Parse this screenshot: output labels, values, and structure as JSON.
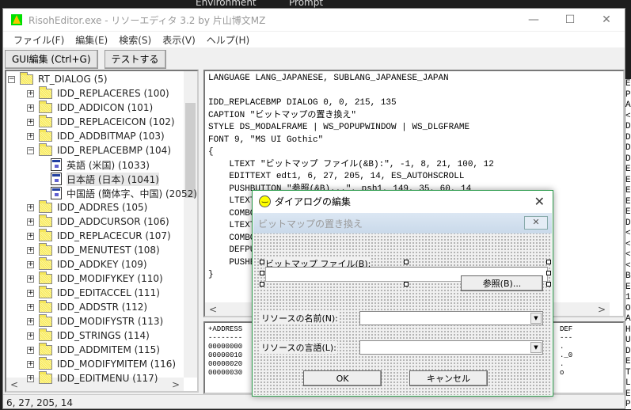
{
  "desktop": {
    "labels": [
      "Environment",
      "Prompt"
    ]
  },
  "window": {
    "title": "RisohEditor.exe - リソーエディタ 3.2 by 片山博文MZ",
    "controls": {
      "minimize": "—",
      "maximize": "☐",
      "close": "✕"
    }
  },
  "menu": [
    "ファイル(F)",
    "編集(E)",
    "検索(S)",
    "表示(V)",
    "ヘルプ(H)"
  ],
  "toolbar": {
    "gui_edit": "GUI編集 (Ctrl+G)",
    "test": "テストする"
  },
  "tree": {
    "root": "RT_DIALOG (5)",
    "items": [
      {
        "label": "IDD_REPLACERES (100)",
        "expanded": false
      },
      {
        "label": "IDD_ADDICON (101)",
        "expanded": false
      },
      {
        "label": "IDD_REPLACEICON (102)",
        "expanded": false
      },
      {
        "label": "IDD_ADDBITMAP (103)",
        "expanded": false
      },
      {
        "label": "IDD_REPLACEBMP (104)",
        "expanded": true,
        "children": [
          "英語 (米国) (1033)",
          "日本語 (日本) (1041)",
          "中国語 (簡体字、中国) (2052)"
        ],
        "selected_child": 1
      },
      {
        "label": "IDD_ADDRES (105)",
        "expanded": false
      },
      {
        "label": "IDD_ADDCURSOR (106)",
        "expanded": false
      },
      {
        "label": "IDD_REPLACECUR (107)",
        "expanded": false
      },
      {
        "label": "IDD_MENUTEST (108)",
        "expanded": false
      },
      {
        "label": "IDD_ADDKEY (109)",
        "expanded": false
      },
      {
        "label": "IDD_MODIFYKEY (110)",
        "expanded": false
      },
      {
        "label": "IDD_EDITACCEL (111)",
        "expanded": false
      },
      {
        "label": "IDD_ADDSTR (112)",
        "expanded": false
      },
      {
        "label": "IDD_MODIFYSTR (113)",
        "expanded": false
      },
      {
        "label": "IDD_STRINGS (114)",
        "expanded": false
      },
      {
        "label": "IDD_ADDMITEM (115)",
        "expanded": false
      },
      {
        "label": "IDD_MODIFYMITEM (116)",
        "expanded": false
      },
      {
        "label": "IDD_EDITMENU (117)",
        "expanded": false
      }
    ]
  },
  "code": "LANGUAGE LANG_JAPANESE, SUBLANG_JAPANESE_JAPAN\n\nIDD_REPLACEBMP DIALOG 0, 0, 215, 135\nCAPTION \"ビットマップの置き換え\"\nSTYLE DS_MODALFRAME | WS_POPUPWINDOW | WS_DLGFRAME\nFONT 9, \"MS UI Gothic\"\n{\n    LTEXT \"ビットマップ ファイル(&B):\", -1, 8, 21, 100, 12\n    EDITTEXT edt1, 6, 27, 205, 14, ES_AUTOHSCROLL\n    PUSHBUTTON \"参照(&B)...\", psh1, 149, 35, 60, 14\n    LTEXT \"リソースの名前(&N):\", -1, 5, 67, 70, 12\n    COMBOBOX                                        SCROLL | C\n    LTEXT\n    COMBOBOX                                        SCROLL | C\n    DEFPUSHBUTTON\n    PUSHBUTTON\n}",
  "hex": "+ADDRESS                                        DEF\n--------                                        ---\n00000000                                        .\n00000010                                        ._0\n00000020                                        .\n00000030                                        o",
  "status": "6, 27, 205, 14",
  "background_window_chars": "E\nP\nA\n<\nD\nD\nD\nD\nE\nE\nE\nE\nE\nD\n<\n<\n<\n<\nB\nE\n1\nO\nA\nH\nU\nD\nE\nT\nL\nE\nP\nT",
  "edit_dialog": {
    "title": "ダイアログの編集",
    "close": "✕",
    "preview": {
      "caption": "ビットマップの置き換え",
      "caption_close": "✕",
      "label_file": "ビットマップ ファイル(B):",
      "browse": "参照(B)...",
      "label_name": "リソースの名前(N):",
      "label_lang": "リソースの言語(L):",
      "ok": "OK",
      "cancel": "キャンセル"
    }
  }
}
